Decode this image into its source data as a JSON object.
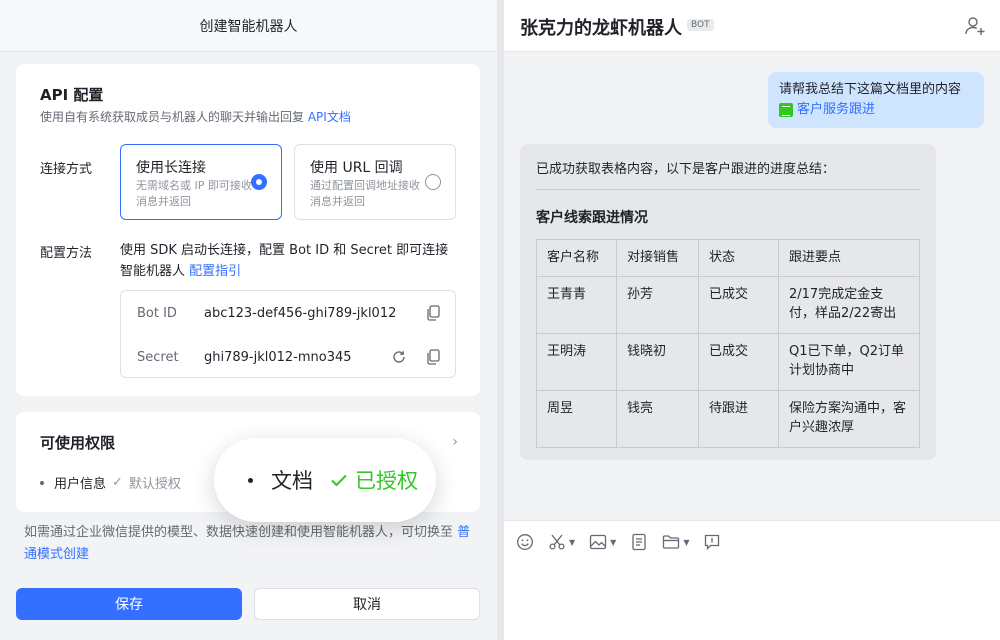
{
  "left": {
    "header_title": "创建智能机器人",
    "api": {
      "title": "API 配置",
      "desc_prefix": "使用自有系统获取成员与机器人的聊天并输出回复",
      "desc_link": "API文档",
      "connection_label": "连接方式",
      "options": [
        {
          "title": "使用长连接",
          "desc": "无需域名或 IP 即可接收消息并返回",
          "selected": true
        },
        {
          "title": "使用 URL 回调",
          "desc": "通过配置回调地址接收消息并返回",
          "selected": false
        }
      ],
      "config_label": "配置方法",
      "config_text": "使用 SDK 启动长连接，配置 Bot ID 和 Secret 即可连接智能机器人",
      "config_link": "配置指引",
      "credentials": [
        {
          "key": "Bot ID",
          "value": "abc123-def456-ghi789-jkl012"
        },
        {
          "key": "Secret",
          "value": "ghi789-jkl012-mno345"
        }
      ]
    },
    "permissions": {
      "title": "可使用权限",
      "item_label": "用户信息",
      "item_status": "默认授权"
    },
    "hint_text": "如需通过企业微信提供的模型、数据快速创建和使用智能机器人，可切换至",
    "hint_link": "普通模式创建",
    "save_label": "保存",
    "cancel_label": "取消"
  },
  "zoom_pill": {
    "name": "文档",
    "status": "已授权"
  },
  "chat": {
    "title": "张克力的龙虾机器人",
    "tag": "BOT",
    "user_message": "请帮我总结下这篇文档里的内容",
    "user_doc": "客户服务跟进",
    "bot_intro": "已成功获取表格内容，以下是客户跟进的进度总结：",
    "bot_heading": "客户线索跟进情况",
    "table": {
      "headers": [
        "客户名称",
        "对接销售",
        "状态",
        "跟进要点"
      ],
      "rows": [
        [
          "王青青",
          "孙芳",
          "已成交",
          "2/17完成定金支付，样品2/22寄出"
        ],
        [
          "王明涛",
          "钱晓初",
          "已成交",
          "Q1已下单，Q2订单计划协商中"
        ],
        [
          "周昱",
          "钱亮",
          "待跟进",
          "保险方案沟通中，客户兴趣浓厚"
        ]
      ]
    }
  },
  "colors": {
    "accent": "#3370ff",
    "success": "#34c724",
    "user_bubble": "#cfe4ff",
    "bot_bubble": "#e6e7ea"
  },
  "icons": [
    "copy-icon",
    "refresh-icon",
    "chevron-right-icon",
    "check-icon",
    "add-user-icon",
    "emoji-icon",
    "scissors-icon",
    "image-icon",
    "note-icon",
    "folder-icon",
    "screen-icon",
    "sheet-icon"
  ]
}
